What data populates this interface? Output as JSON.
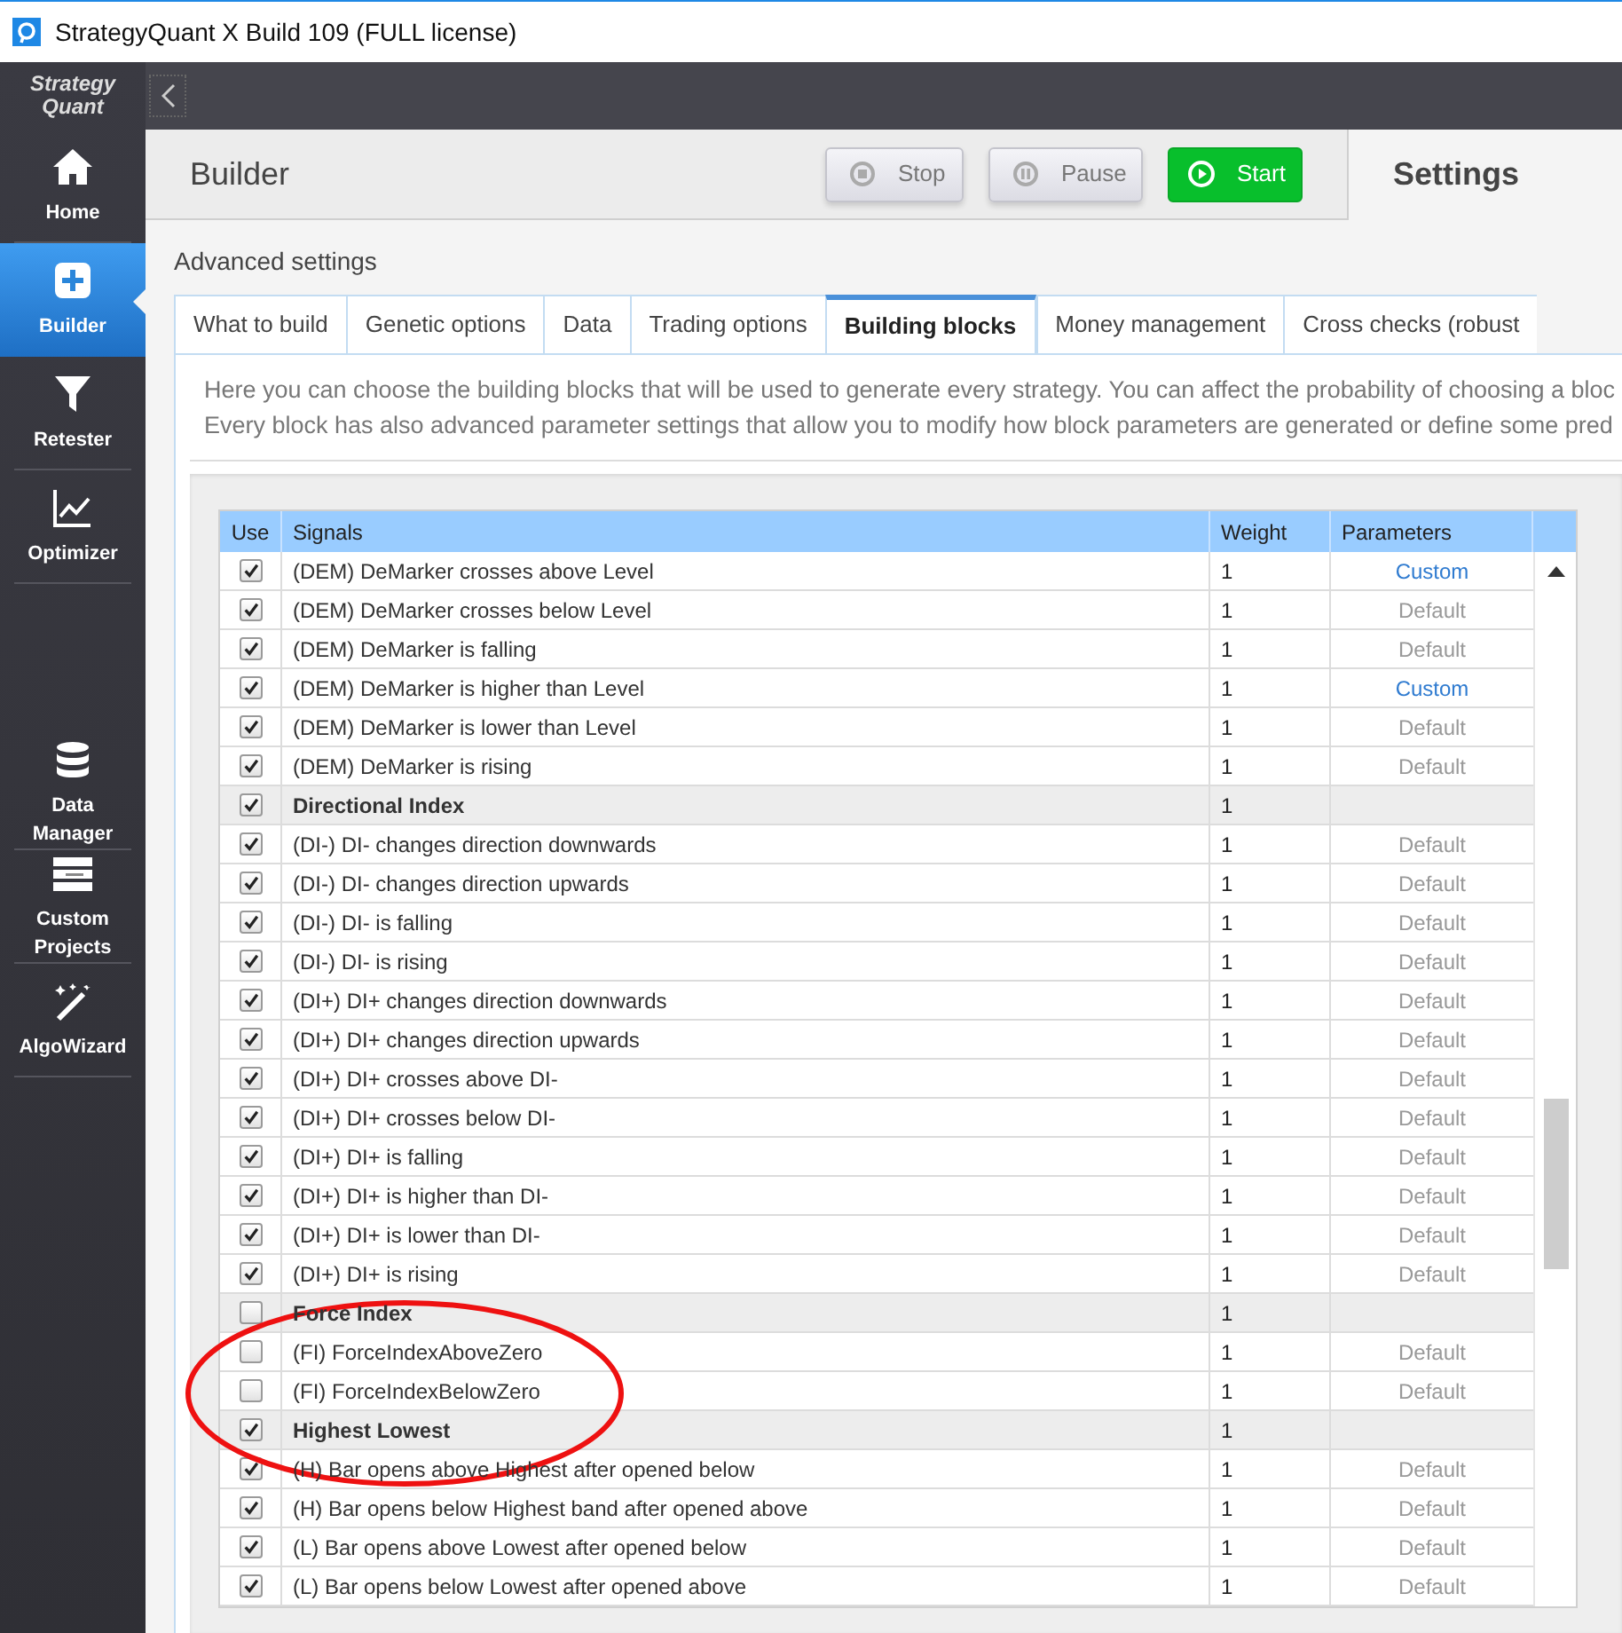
{
  "window": {
    "title": "StrategyQuant X Build 109 (FULL license)"
  },
  "logo": [
    "Strategy",
    "Quant"
  ],
  "sidebar": {
    "items": [
      {
        "label": "Home",
        "selected": false
      },
      {
        "label": "Builder",
        "selected": true
      },
      {
        "label": "Retester",
        "selected": false
      },
      {
        "label": "Optimizer",
        "selected": false
      },
      {
        "label": "Data Manager",
        "selected": false
      },
      {
        "label": "Custom Projects",
        "selected": false
      },
      {
        "label": "AlgoWizard",
        "selected": false
      }
    ]
  },
  "header": {
    "title": "Builder",
    "buttons": [
      {
        "label": "Stop",
        "kind": "stop",
        "disabled": true
      },
      {
        "label": "Pause",
        "kind": "pause",
        "disabled": true
      },
      {
        "label": "Start",
        "kind": "start",
        "disabled": false
      }
    ],
    "settings_title": "Settings"
  },
  "section_title": "Advanced settings",
  "tabs": [
    {
      "label": "What to build",
      "selected": false
    },
    {
      "label": "Genetic options",
      "selected": false
    },
    {
      "label": "Data",
      "selected": false
    },
    {
      "label": "Trading options",
      "selected": false
    },
    {
      "label": "Building blocks",
      "selected": true
    },
    {
      "label": "Money management",
      "selected": false
    },
    {
      "label": "Cross checks (robust",
      "selected": false
    }
  ],
  "description": [
    "Here you can choose the building blocks that will be used to generate every strategy. You can affect the probability of choosing a bloc",
    "Every block has also advanced parameter settings that allow you to modify how block parameters are generated or define some pred"
  ],
  "table": {
    "columns": [
      "Use",
      "Signals",
      "Weight",
      "Parameters"
    ],
    "rows": [
      {
        "kind": "signal",
        "checked": true,
        "name": "(DEM) DeMarker crosses above Level",
        "weight": "1",
        "parameters": "Custom",
        "custom": true
      },
      {
        "kind": "signal",
        "checked": true,
        "name": "(DEM) DeMarker crosses below Level",
        "weight": "1",
        "parameters": "Default",
        "custom": false
      },
      {
        "kind": "signal",
        "checked": true,
        "name": "(DEM) DeMarker is falling",
        "weight": "1",
        "parameters": "Default",
        "custom": false
      },
      {
        "kind": "signal",
        "checked": true,
        "name": "(DEM) DeMarker is higher than Level",
        "weight": "1",
        "parameters": "Custom",
        "custom": true
      },
      {
        "kind": "signal",
        "checked": true,
        "name": "(DEM) DeMarker is lower than Level",
        "weight": "1",
        "parameters": "Default",
        "custom": false
      },
      {
        "kind": "signal",
        "checked": true,
        "name": "(DEM) DeMarker is rising",
        "weight": "1",
        "parameters": "Default",
        "custom": false
      },
      {
        "kind": "group",
        "checked": true,
        "name": "Directional Index",
        "weight": "1"
      },
      {
        "kind": "signal",
        "checked": true,
        "name": "(DI-) DI- changes direction downwards",
        "weight": "1",
        "parameters": "Default",
        "custom": false
      },
      {
        "kind": "signal",
        "checked": true,
        "name": "(DI-) DI- changes direction upwards",
        "weight": "1",
        "parameters": "Default",
        "custom": false
      },
      {
        "kind": "signal",
        "checked": true,
        "name": "(DI-) DI- is falling",
        "weight": "1",
        "parameters": "Default",
        "custom": false
      },
      {
        "kind": "signal",
        "checked": true,
        "name": "(DI-) DI- is rising",
        "weight": "1",
        "parameters": "Default",
        "custom": false
      },
      {
        "kind": "signal",
        "checked": true,
        "name": "(DI+) DI+ changes direction downwards",
        "weight": "1",
        "parameters": "Default",
        "custom": false
      },
      {
        "kind": "signal",
        "checked": true,
        "name": "(DI+) DI+ changes direction upwards",
        "weight": "1",
        "parameters": "Default",
        "custom": false
      },
      {
        "kind": "signal",
        "checked": true,
        "name": "(DI+) DI+ crosses above DI-",
        "weight": "1",
        "parameters": "Default",
        "custom": false
      },
      {
        "kind": "signal",
        "checked": true,
        "name": "(DI+) DI+ crosses below DI-",
        "weight": "1",
        "parameters": "Default",
        "custom": false
      },
      {
        "kind": "signal",
        "checked": true,
        "name": "(DI+) DI+ is falling",
        "weight": "1",
        "parameters": "Default",
        "custom": false
      },
      {
        "kind": "signal",
        "checked": true,
        "name": "(DI+) DI+ is higher than DI-",
        "weight": "1",
        "parameters": "Default",
        "custom": false
      },
      {
        "kind": "signal",
        "checked": true,
        "name": "(DI+) DI+ is lower than DI-",
        "weight": "1",
        "parameters": "Default",
        "custom": false
      },
      {
        "kind": "signal",
        "checked": true,
        "name": "(DI+) DI+ is rising",
        "weight": "1",
        "parameters": "Default",
        "custom": false
      },
      {
        "kind": "group",
        "checked": false,
        "name": "Force Index",
        "weight": "1"
      },
      {
        "kind": "signal",
        "checked": false,
        "name": "(FI) ForceIndexAboveZero",
        "weight": "1",
        "parameters": "Default",
        "custom": false
      },
      {
        "kind": "signal",
        "checked": false,
        "name": "(FI) ForceIndexBelowZero",
        "weight": "1",
        "parameters": "Default",
        "custom": false
      },
      {
        "kind": "group",
        "checked": true,
        "name": "Highest Lowest",
        "weight": "1"
      },
      {
        "kind": "signal",
        "checked": true,
        "name": "(H) Bar opens above Highest after opened below",
        "weight": "1",
        "parameters": "Default",
        "custom": false
      },
      {
        "kind": "signal",
        "checked": true,
        "name": "(H) Bar opens below Highest band after opened above",
        "weight": "1",
        "parameters": "Default",
        "custom": false
      },
      {
        "kind": "signal",
        "checked": true,
        "name": "(L) Bar opens above Lowest after opened below",
        "weight": "1",
        "parameters": "Default",
        "custom": false
      },
      {
        "kind": "signal",
        "checked": true,
        "name": "(L) Bar opens below Lowest after opened above",
        "weight": "1",
        "parameters": "Default",
        "custom": false
      }
    ]
  }
}
